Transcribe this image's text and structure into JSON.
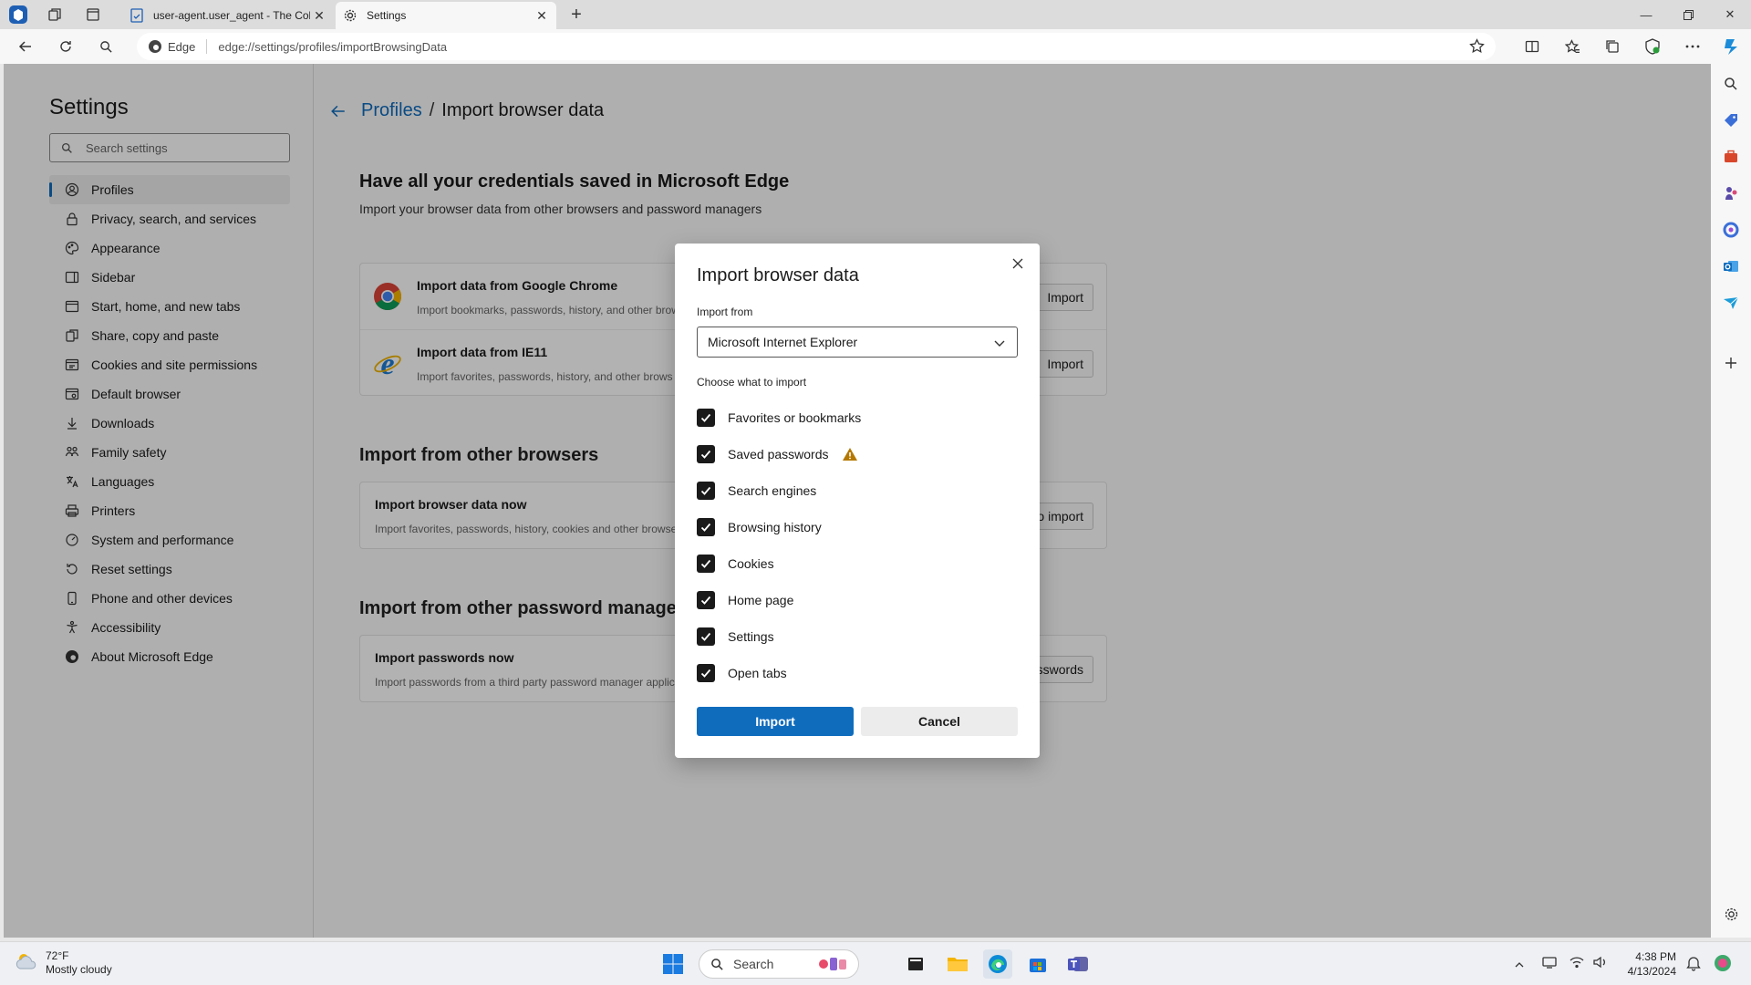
{
  "browser": {
    "tabs": [
      {
        "title": "user-agent.user_agent - The Coll",
        "active": false
      },
      {
        "title": "Settings",
        "active": true
      }
    ],
    "site_label": "Edge",
    "url": "edge://settings/profiles/importBrowsingData"
  },
  "sidebar": {
    "title": "Settings",
    "search_placeholder": "Search settings",
    "items": [
      {
        "label": "Profiles",
        "icon": "profile-icon"
      },
      {
        "label": "Privacy, search, and services",
        "icon": "lock-icon"
      },
      {
        "label": "Appearance",
        "icon": "palette-icon"
      },
      {
        "label": "Sidebar",
        "icon": "sidebar-icon"
      },
      {
        "label": "Start, home, and new tabs",
        "icon": "home-icon"
      },
      {
        "label": "Share, copy and paste",
        "icon": "share-icon"
      },
      {
        "label": "Cookies and site permissions",
        "icon": "cookies-icon"
      },
      {
        "label": "Default browser",
        "icon": "browser-icon"
      },
      {
        "label": "Downloads",
        "icon": "download-icon"
      },
      {
        "label": "Family safety",
        "icon": "family-icon"
      },
      {
        "label": "Languages",
        "icon": "languages-icon"
      },
      {
        "label": "Printers",
        "icon": "printer-icon"
      },
      {
        "label": "System and performance",
        "icon": "system-icon"
      },
      {
        "label": "Reset settings",
        "icon": "reset-icon"
      },
      {
        "label": "Phone and other devices",
        "icon": "phone-icon"
      },
      {
        "label": "Accessibility",
        "icon": "accessibility-icon"
      },
      {
        "label": "About Microsoft Edge",
        "icon": "edge-icon"
      }
    ]
  },
  "main": {
    "breadcrumb_link": "Profiles",
    "breadcrumb_sep": "/",
    "breadcrumb_current": "Import browser data",
    "heading": "Have all your credentials saved in Microsoft Edge",
    "subheading": "Import your browser data from other browsers and password managers",
    "import_cards": [
      {
        "title": "Import data from Google Chrome",
        "desc": "Import bookmarks, passwords, history, and other brow",
        "button": "Import"
      },
      {
        "title": "Import data from IE11",
        "desc": "Import favorites, passwords, history, and other brows",
        "button": "Import"
      }
    ],
    "other_browsers_heading": "Import from other browsers",
    "other_browsers_card": {
      "title": "Import browser data now",
      "desc": "Import favorites, passwords, history, cookies and other browse",
      "button": "o import"
    },
    "password_managers_heading": "Import from other password managers",
    "password_card": {
      "title": "Import passwords now",
      "desc": "Import passwords from a third party password manager applic",
      "button": "sswords"
    }
  },
  "dialog": {
    "title": "Import browser data",
    "import_from_label": "Import from",
    "selected_source": "Microsoft Internet Explorer",
    "choose_label": "Choose what to import",
    "options": [
      {
        "label": "Favorites or bookmarks",
        "checked": true
      },
      {
        "label": "Saved passwords",
        "checked": true,
        "warning": true
      },
      {
        "label": "Search engines",
        "checked": true
      },
      {
        "label": "Browsing history",
        "checked": true
      },
      {
        "label": "Cookies",
        "checked": true
      },
      {
        "label": "Home page",
        "checked": true
      },
      {
        "label": "Settings",
        "checked": true
      },
      {
        "label": "Open tabs",
        "checked": true
      }
    ],
    "import_button": "Import",
    "cancel_button": "Cancel"
  },
  "taskbar": {
    "weather_temp": "72°F",
    "weather_desc": "Mostly cloudy",
    "search_placeholder": "Search",
    "time": "4:38 PM",
    "date": "4/13/2024"
  },
  "colors": {
    "accent": "#0f6cbd",
    "warning": "#b47800"
  }
}
